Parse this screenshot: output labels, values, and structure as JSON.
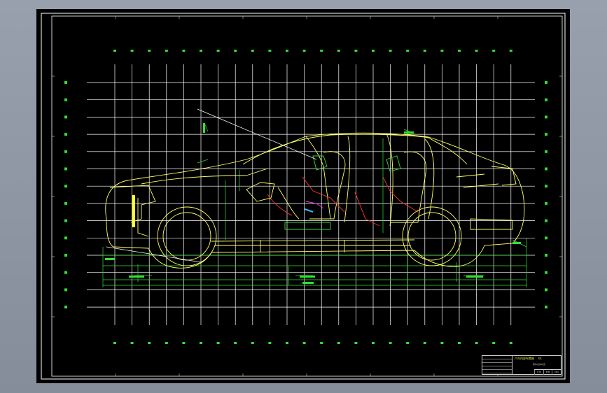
{
  "title_block": {
    "drawing_name": "汽车内部布置图",
    "drawing_code": "01",
    "sub_label": "轿车总体布置",
    "cells": [
      "比例",
      "数量",
      "材料"
    ]
  },
  "colors": {
    "sheet": "#000000",
    "border": "#ffffff",
    "grid": "#ffffff",
    "body_outline": "#ffff66",
    "dimensions": "#33dd33",
    "interior_red": "#ff3333",
    "interior_blue": "#33bbff",
    "interior_magenta": "#ff33ff"
  },
  "icons": {
    "title_block": "cad-title-block-icon"
  }
}
